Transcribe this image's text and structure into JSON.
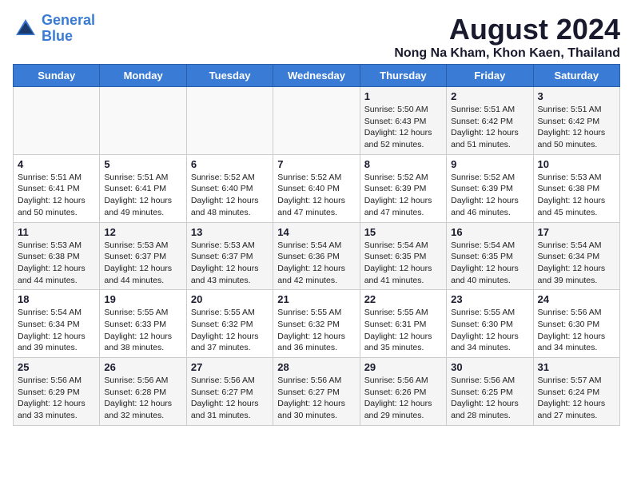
{
  "header": {
    "logo_line1": "General",
    "logo_line2": "Blue",
    "month_title": "August 2024",
    "location": "Nong Na Kham, Khon Kaen, Thailand"
  },
  "weekdays": [
    "Sunday",
    "Monday",
    "Tuesday",
    "Wednesday",
    "Thursday",
    "Friday",
    "Saturday"
  ],
  "weeks": [
    [
      {
        "day": "",
        "info": ""
      },
      {
        "day": "",
        "info": ""
      },
      {
        "day": "",
        "info": ""
      },
      {
        "day": "",
        "info": ""
      },
      {
        "day": "1",
        "info": "Sunrise: 5:50 AM\nSunset: 6:43 PM\nDaylight: 12 hours\nand 52 minutes."
      },
      {
        "day": "2",
        "info": "Sunrise: 5:51 AM\nSunset: 6:42 PM\nDaylight: 12 hours\nand 51 minutes."
      },
      {
        "day": "3",
        "info": "Sunrise: 5:51 AM\nSunset: 6:42 PM\nDaylight: 12 hours\nand 50 minutes."
      }
    ],
    [
      {
        "day": "4",
        "info": "Sunrise: 5:51 AM\nSunset: 6:41 PM\nDaylight: 12 hours\nand 50 minutes."
      },
      {
        "day": "5",
        "info": "Sunrise: 5:51 AM\nSunset: 6:41 PM\nDaylight: 12 hours\nand 49 minutes."
      },
      {
        "day": "6",
        "info": "Sunrise: 5:52 AM\nSunset: 6:40 PM\nDaylight: 12 hours\nand 48 minutes."
      },
      {
        "day": "7",
        "info": "Sunrise: 5:52 AM\nSunset: 6:40 PM\nDaylight: 12 hours\nand 47 minutes."
      },
      {
        "day": "8",
        "info": "Sunrise: 5:52 AM\nSunset: 6:39 PM\nDaylight: 12 hours\nand 47 minutes."
      },
      {
        "day": "9",
        "info": "Sunrise: 5:52 AM\nSunset: 6:39 PM\nDaylight: 12 hours\nand 46 minutes."
      },
      {
        "day": "10",
        "info": "Sunrise: 5:53 AM\nSunset: 6:38 PM\nDaylight: 12 hours\nand 45 minutes."
      }
    ],
    [
      {
        "day": "11",
        "info": "Sunrise: 5:53 AM\nSunset: 6:38 PM\nDaylight: 12 hours\nand 44 minutes."
      },
      {
        "day": "12",
        "info": "Sunrise: 5:53 AM\nSunset: 6:37 PM\nDaylight: 12 hours\nand 44 minutes."
      },
      {
        "day": "13",
        "info": "Sunrise: 5:53 AM\nSunset: 6:37 PM\nDaylight: 12 hours\nand 43 minutes."
      },
      {
        "day": "14",
        "info": "Sunrise: 5:54 AM\nSunset: 6:36 PM\nDaylight: 12 hours\nand 42 minutes."
      },
      {
        "day": "15",
        "info": "Sunrise: 5:54 AM\nSunset: 6:35 PM\nDaylight: 12 hours\nand 41 minutes."
      },
      {
        "day": "16",
        "info": "Sunrise: 5:54 AM\nSunset: 6:35 PM\nDaylight: 12 hours\nand 40 minutes."
      },
      {
        "day": "17",
        "info": "Sunrise: 5:54 AM\nSunset: 6:34 PM\nDaylight: 12 hours\nand 39 minutes."
      }
    ],
    [
      {
        "day": "18",
        "info": "Sunrise: 5:54 AM\nSunset: 6:34 PM\nDaylight: 12 hours\nand 39 minutes."
      },
      {
        "day": "19",
        "info": "Sunrise: 5:55 AM\nSunset: 6:33 PM\nDaylight: 12 hours\nand 38 minutes."
      },
      {
        "day": "20",
        "info": "Sunrise: 5:55 AM\nSunset: 6:32 PM\nDaylight: 12 hours\nand 37 minutes."
      },
      {
        "day": "21",
        "info": "Sunrise: 5:55 AM\nSunset: 6:32 PM\nDaylight: 12 hours\nand 36 minutes."
      },
      {
        "day": "22",
        "info": "Sunrise: 5:55 AM\nSunset: 6:31 PM\nDaylight: 12 hours\nand 35 minutes."
      },
      {
        "day": "23",
        "info": "Sunrise: 5:55 AM\nSunset: 6:30 PM\nDaylight: 12 hours\nand 34 minutes."
      },
      {
        "day": "24",
        "info": "Sunrise: 5:56 AM\nSunset: 6:30 PM\nDaylight: 12 hours\nand 34 minutes."
      }
    ],
    [
      {
        "day": "25",
        "info": "Sunrise: 5:56 AM\nSunset: 6:29 PM\nDaylight: 12 hours\nand 33 minutes."
      },
      {
        "day": "26",
        "info": "Sunrise: 5:56 AM\nSunset: 6:28 PM\nDaylight: 12 hours\nand 32 minutes."
      },
      {
        "day": "27",
        "info": "Sunrise: 5:56 AM\nSunset: 6:27 PM\nDaylight: 12 hours\nand 31 minutes."
      },
      {
        "day": "28",
        "info": "Sunrise: 5:56 AM\nSunset: 6:27 PM\nDaylight: 12 hours\nand 30 minutes."
      },
      {
        "day": "29",
        "info": "Sunrise: 5:56 AM\nSunset: 6:26 PM\nDaylight: 12 hours\nand 29 minutes."
      },
      {
        "day": "30",
        "info": "Sunrise: 5:56 AM\nSunset: 6:25 PM\nDaylight: 12 hours\nand 28 minutes."
      },
      {
        "day": "31",
        "info": "Sunrise: 5:57 AM\nSunset: 6:24 PM\nDaylight: 12 hours\nand 27 minutes."
      }
    ]
  ]
}
